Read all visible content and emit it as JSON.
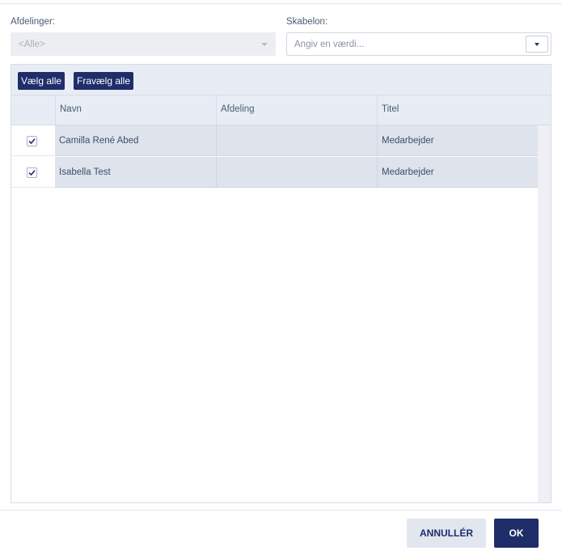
{
  "filters": {
    "departments_label": "Afdelinger:",
    "departments_value": "<Alle>",
    "template_label": "Skabelon:",
    "template_placeholder": "Angiv en værdi..."
  },
  "toolbar": {
    "select_all_label": "Vælg alle",
    "deselect_all_label": "Fravælg alle"
  },
  "table": {
    "columns": [
      "",
      "Navn",
      "Afdeling",
      "Titel"
    ],
    "rows": [
      {
        "checked": true,
        "name": "Camilla René Abed",
        "department": "",
        "title": "Medarbejder"
      },
      {
        "checked": true,
        "name": "Isabella Test",
        "department": "",
        "title": "Medarbejder"
      }
    ]
  },
  "footer": {
    "cancel_label": "ANNULLÉR",
    "ok_label": "OK"
  },
  "colors": {
    "primary": "#1f2d69",
    "row_background": "#dfe3ec",
    "header_background": "#e8ecf4"
  },
  "icons": {
    "checkbox": "check-icon",
    "dropdown": "caret-down-icon"
  }
}
